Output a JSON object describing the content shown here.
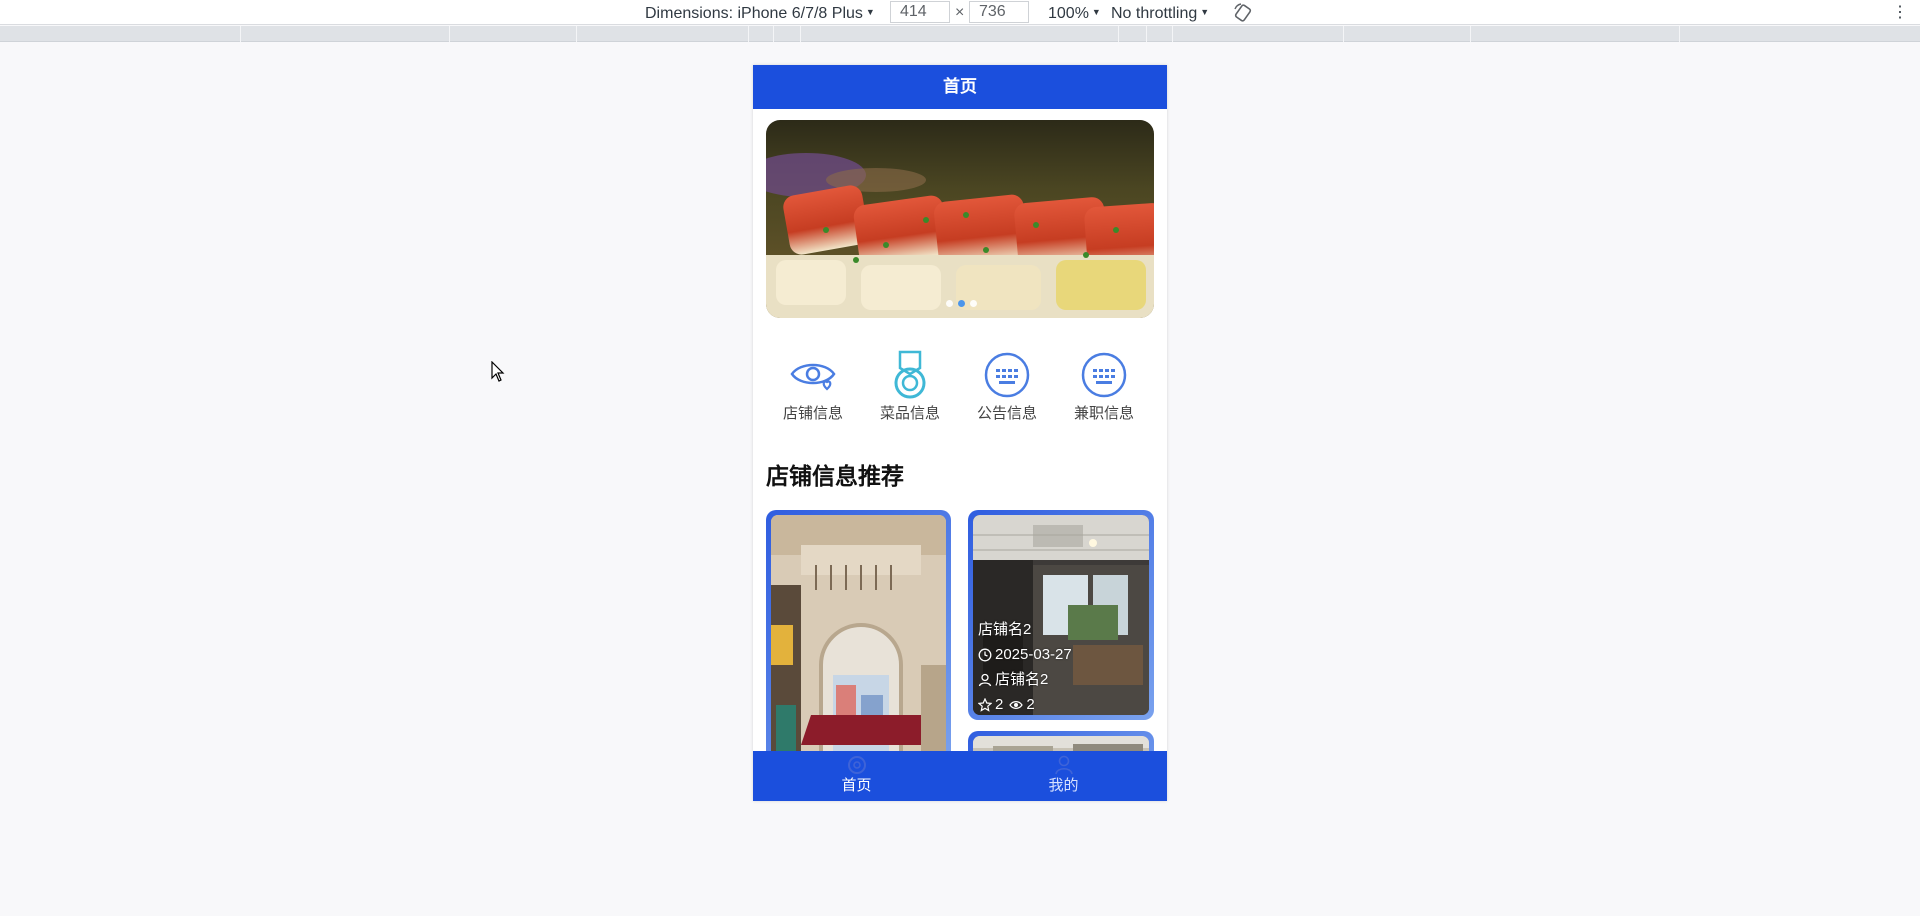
{
  "devtools": {
    "dimensions_label": "Dimensions: iPhone 6/7/8 Plus",
    "width": "414",
    "times": "×",
    "height": "736",
    "zoom": "100%",
    "throttling": "No throttling",
    "more_icon": "more-vertical-icon",
    "rotate_icon": "rotate-icon"
  },
  "app": {
    "header_title": "首页",
    "banner": {
      "dots": 3,
      "active_dot": 1
    },
    "shortcuts": [
      {
        "label": "店铺信息",
        "icon": "eye-heart-icon",
        "color": "#4a7de2"
      },
      {
        "label": "菜品信息",
        "icon": "medal-icon",
        "color": "#3fb8d6"
      },
      {
        "label": "公告信息",
        "icon": "keyboard-icon",
        "color": "#4a7de2"
      },
      {
        "label": "兼职信息",
        "icon": "keyboard-icon",
        "color": "#4a7de2"
      }
    ],
    "section_title": "店铺信息推荐",
    "cards": [
      {
        "name": "",
        "date": "",
        "owner": "",
        "stars": "",
        "views": ""
      },
      {
        "name": "店铺名2",
        "date": "2025-03-27",
        "owner": "店铺名2",
        "stars": "2",
        "views": "2"
      }
    ],
    "tabbar": [
      {
        "label": "首页",
        "icon": "home-icon",
        "active": true
      },
      {
        "label": "我的",
        "icon": "user-icon",
        "active": false
      }
    ],
    "colors": {
      "primary": "#1b4fdd",
      "icon_blue": "#4a7de2",
      "icon_teal": "#3fb8d6"
    }
  }
}
